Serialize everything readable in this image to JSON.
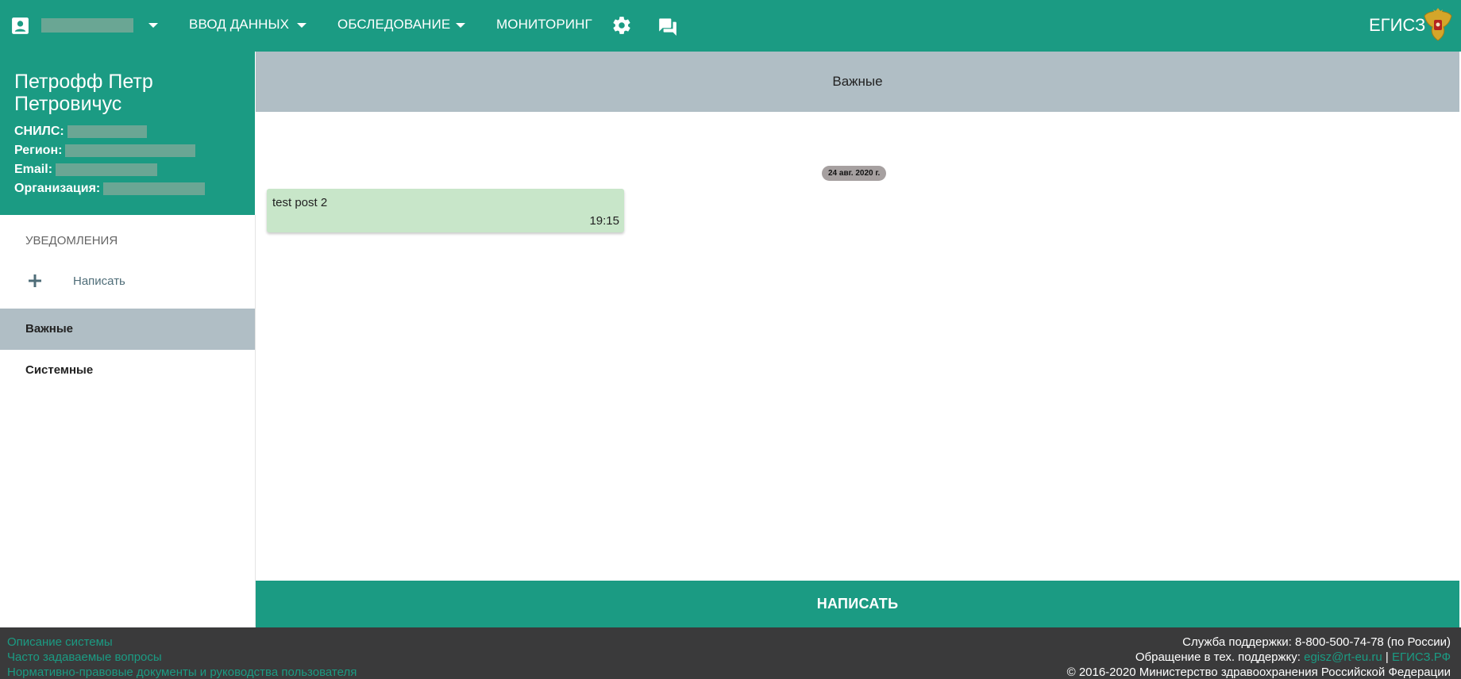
{
  "topbar": {
    "nav": {
      "data_entry": "ВВОД ДАННЫХ",
      "survey": "ОБСЛЕДОВАНИЕ",
      "monitoring": "МОНИТОРИНГ"
    },
    "brand": "ЕГИСЗ"
  },
  "profile": {
    "name": "Петрофф Петр Петровичус",
    "snils_label": "СНИЛС:",
    "region_label": "Регион:",
    "email_label": "Email:",
    "org_label": "Организация:"
  },
  "sidebar": {
    "heading": "УВЕДОМЛЕНИЯ",
    "write_label": "Написать",
    "items": [
      {
        "label": "Важные",
        "active": true
      },
      {
        "label": "Системные",
        "active": false
      }
    ]
  },
  "main": {
    "header": "Важные",
    "date": "24 авг. 2020 г.",
    "messages": [
      {
        "text": "test post 2",
        "time": "19:15"
      }
    ],
    "write_button": "НАПИСАТЬ"
  },
  "footer": {
    "links": [
      "Описание системы",
      "Часто задаваемые вопросы",
      "Нормативно-правовые документы и руководства пользователя"
    ],
    "support_line": "Служба поддержки: 8-800-500-74-78 (по России)",
    "appeal_prefix": "Обращение в тех. поддержку:",
    "appeal_email": "egisz@rt-eu.ru",
    "separator": "|",
    "appeal_site": "ЕГИСЗ.РФ",
    "copyright": "© 2016-2020 Министерство здравоохранения Российской Федерации"
  },
  "colors": {
    "primary": "#1b9b83",
    "header_gray": "#b0bec5",
    "message_bg": "#c8e6c9",
    "footer_bg": "#3a3a3b"
  },
  "icons": [
    "account-box-icon",
    "chevron-down-icon",
    "gear-icon",
    "chat-icon",
    "emblem-icon",
    "plus-icon"
  ]
}
